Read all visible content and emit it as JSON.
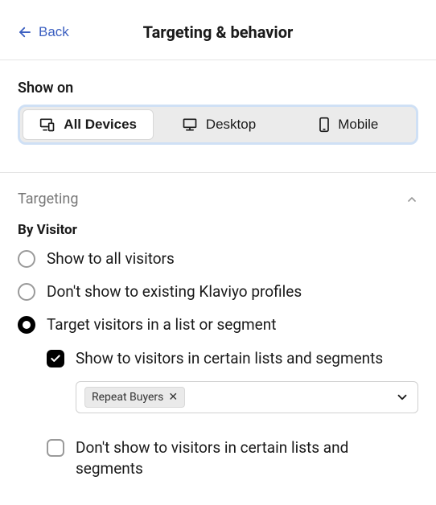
{
  "header": {
    "back_label": "Back",
    "title": "Targeting & behavior"
  },
  "show_on": {
    "label": "Show on",
    "options": [
      {
        "id": "all",
        "label": "All Devices",
        "icon": "devices-icon",
        "active": true
      },
      {
        "id": "desktop",
        "label": "Desktop",
        "icon": "desktop-icon",
        "active": false
      },
      {
        "id": "mobile",
        "label": "Mobile",
        "icon": "mobile-icon",
        "active": false
      }
    ]
  },
  "targeting": {
    "section_title": "Targeting",
    "by_visitor_label": "By Visitor",
    "radios": [
      {
        "id": "all",
        "label": "Show to all visitors",
        "selected": false
      },
      {
        "id": "exclude-klaviyo",
        "label": "Don't show to existing Klaviyo profiles",
        "selected": false
      },
      {
        "id": "list-segment",
        "label": "Target visitors in a list or segment",
        "selected": true
      }
    ],
    "nested": {
      "show_to": {
        "label": "Show to visitors in certain lists and segments",
        "checked": true,
        "selected_chip": "Repeat Buyers"
      },
      "dont_show_to": {
        "label": "Don't show to visitors in certain lists and segments",
        "checked": false
      }
    }
  }
}
